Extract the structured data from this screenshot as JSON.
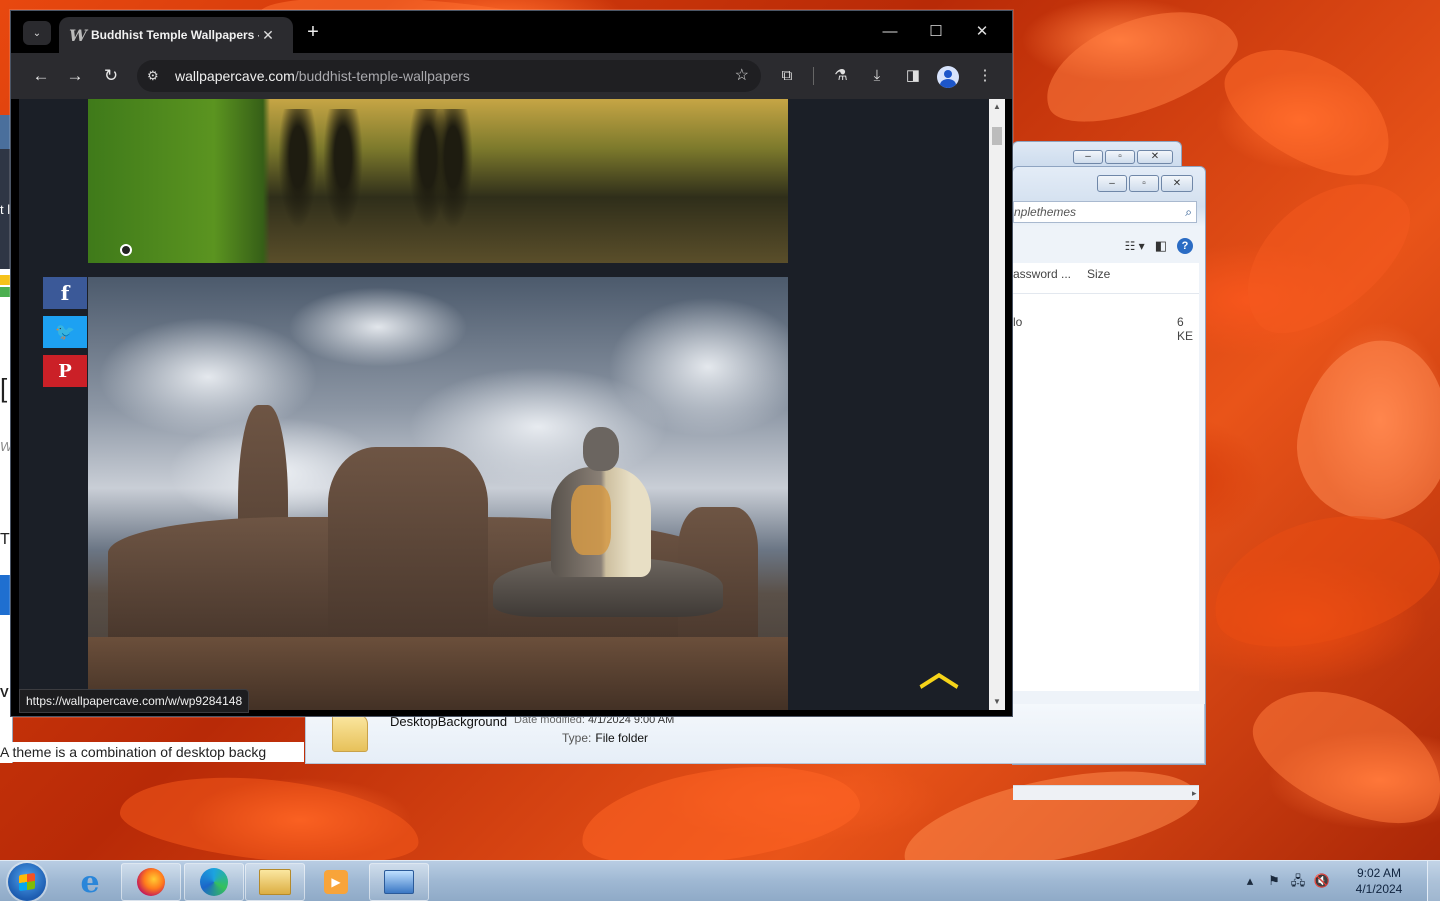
{
  "browser": {
    "tab_title": "Buddhist Temple Wallpapers - ",
    "tab_favicon": "W",
    "url_host": "wallpapercave.com",
    "url_path": "/buddhist-temple-wallpapers",
    "status_link": "https://wallpapercave.com/w/wp9284148"
  },
  "page": {
    "share": [
      {
        "name": "facebook",
        "glyph": "f",
        "color": "#3b5998"
      },
      {
        "name": "twitter",
        "glyph": "🐦",
        "color": "#1da1f2"
      },
      {
        "name": "pinterest",
        "glyph": "P",
        "color": "#cb2027"
      }
    ],
    "scroll_top_color": "#f6d419",
    "background": "#1b1f27"
  },
  "explorer": {
    "search_text": "nplethemes",
    "col_name": "assword ...",
    "col_size": "Size",
    "row_name": "lo",
    "row_size": "6 KE",
    "details": {
      "name": "DesktopBackground",
      "modified_label": "Date modified:",
      "modified_value": "4/1/2024 9:00 AM",
      "type_label": "Type:",
      "type_value": "File folder"
    }
  },
  "background_window": {
    "snippet": "A theme is a combination of desktop backg",
    "edge_chars": [
      "t l",
      "[",
      "W",
      "T",
      "V"
    ]
  },
  "taskbar": {
    "apps": [
      "internet-explorer",
      "firefox",
      "edge",
      "file-explorer",
      "media-player",
      "control-panel"
    ],
    "clock_time": "9:02 AM",
    "clock_date": "4/1/2024"
  }
}
